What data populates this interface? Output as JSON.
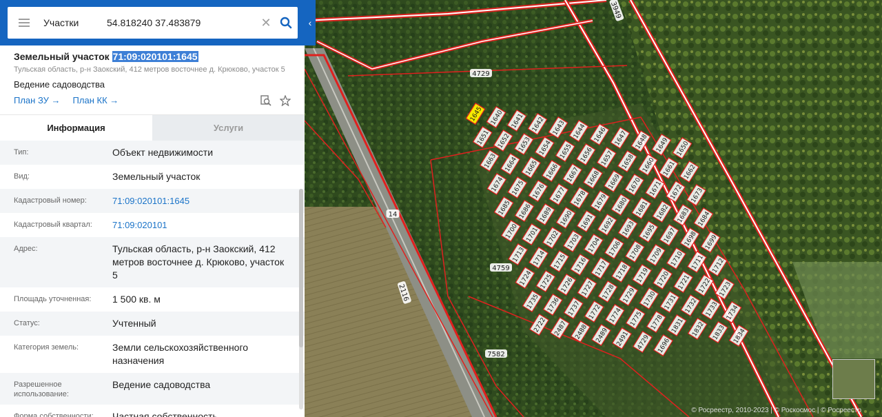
{
  "search": {
    "layer": "Участки",
    "value": "54.818240 37.483879",
    "clear_symbol": "✕"
  },
  "parcel": {
    "title_prefix": "Земельный участок",
    "cadastral_number": "71:09:020101:1645",
    "address": "Тульская область, р-н Заокский, 412 метров восточнее д. Крюково, участок 5",
    "use": "Ведение садоводства",
    "plan_zu": "План ЗУ",
    "plan_kk": "План КК",
    "arrow": "→"
  },
  "tabs": {
    "info": "Информация",
    "services": "Услуги"
  },
  "properties": [
    {
      "key": "Тип:",
      "value": "Объект недвижимости"
    },
    {
      "key": "Вид:",
      "value": "Земельный участок"
    },
    {
      "key": "Кадастровый номер:",
      "value": "71:09:020101:1645"
    },
    {
      "key": "Кадастровый квартал:",
      "value": "71:09:020101"
    },
    {
      "key": "Адрес:",
      "value": "Тульская область, р-н Заокский, 412 метров восточнее д. Крюково, участок 5"
    },
    {
      "key": "Площадь уточненная:",
      "value": "1 500 кв. м"
    },
    {
      "key": "Статус:",
      "value": "Учтенный"
    },
    {
      "key": "Категория земель:",
      "value": "Земли сельскохозяйственного назначения"
    },
    {
      "key": "Разрешенное использование:",
      "value": "Ведение садоводства"
    },
    {
      "key": "Форма собственности:",
      "value": "Частная собственность"
    }
  ],
  "map": {
    "labels": [
      "4729",
      "4759",
      "7582",
      "2116",
      "3949",
      "14"
    ],
    "plots": [
      "1645",
      "1640",
      "1641",
      "1642",
      "1643",
      "1644",
      "1646",
      "1647",
      "1648",
      "1649",
      "1650",
      "1651",
      "1652",
      "1653",
      "1654",
      "1655",
      "1656",
      "1657",
      "1658",
      "1660",
      "1661",
      "1662",
      "1663",
      "1664",
      "1665",
      "1666",
      "1667",
      "1668",
      "1669",
      "1670",
      "1671",
      "1672",
      "1673",
      "1674",
      "1675",
      "1676",
      "1677",
      "1678",
      "1679",
      "1680",
      "1681",
      "1682",
      "1683",
      "1684",
      "1685",
      "1686",
      "1689",
      "1690",
      "1691",
      "1692",
      "1693",
      "1695",
      "1697",
      "1698",
      "1699",
      "1700",
      "1701",
      "1702",
      "1703",
      "1704",
      "1706",
      "1708",
      "1709",
      "1710",
      "1711",
      "1712",
      "1713",
      "1714",
      "1715",
      "1716",
      "1717",
      "1718",
      "1719",
      "1720",
      "1721",
      "1722",
      "1723",
      "1724",
      "1725",
      "1726",
      "1727",
      "1728",
      "1729",
      "1730",
      "1731",
      "1732",
      "1733",
      "1734",
      "1735",
      "1736",
      "1737",
      "1772",
      "1774",
      "1775",
      "1778",
      "1831",
      "1832",
      "1833",
      "1834",
      "2722",
      "2487",
      "2488",
      "2489",
      "2491",
      "4729",
      "1696"
    ],
    "copyright": "© Росреестр, 2010-2023 | © Роскосмос | © Росреестр"
  },
  "colors": {
    "header_blue": "#1565c0",
    "link_blue": "#1a73c8",
    "highlight": "#3d7fd6",
    "boundary_red": "#e0201e",
    "selected_plot": "#f5e800"
  }
}
